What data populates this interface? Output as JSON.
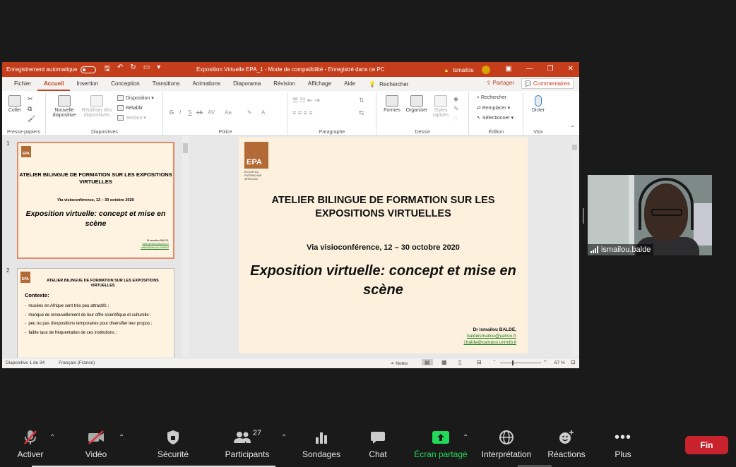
{
  "powerpoint": {
    "titlebar": {
      "autosave_label": "Enregistrement automatique",
      "doc_title": "Exposition Virtuelle EPA_1  -  Mode de compatibilité  -  Enregistré dans ce PC",
      "user": "Ismailou",
      "user_initial": "I"
    },
    "tabs": [
      "Fichier",
      "Accueil",
      "Insertion",
      "Conception",
      "Transitions",
      "Animations",
      "Diaporama",
      "Révision",
      "Affichage",
      "Aide"
    ],
    "search_label": "Rechercher",
    "share_label": "Partager",
    "comments_label": "Commentaires",
    "ribbon": {
      "clipboard": {
        "paste": "Coller",
        "group": "Presse-papiers"
      },
      "slides": {
        "new_slide": "Nouvelle diapositive",
        "reuse": "Réutiliser des diapositives",
        "layout": "Disposition",
        "reset": "Rétablir",
        "section": "Section",
        "group": "Diapositives"
      },
      "font": {
        "group": "Police",
        "bold": "G",
        "italic": "I",
        "underline": "S",
        "strike": "ab",
        "spacing": "AV",
        "case": "Aa"
      },
      "paragraph": {
        "group": "Paragraphe"
      },
      "drawing": {
        "shapes": "Formes",
        "arrange": "Organiser",
        "quick_styles": "Styles rapides",
        "group": "Dessin"
      },
      "editing": {
        "find": "Rechercher",
        "replace": "Remplacer",
        "select": "Sélectionner",
        "group": "Édition"
      },
      "voice": {
        "dictate": "Dicter",
        "group": "Voix"
      }
    },
    "thumbnails": [
      {
        "number": "1",
        "title": "ATELIER BILINGUE DE FORMATION SUR LES EXPOSITIONS VIRTUELLES",
        "via": "Via visioconférence, 12 – 30 octobre 2020",
        "expo": "Exposition virtuelle: concept et mise en scène",
        "author": "Dr Ismailou BALDE,",
        "email1": "baldeismailou@yahoo.fr",
        "email2": "i.balde@campus.unimib.it"
      },
      {
        "number": "2",
        "title": "ATELIER BILINGUE DE FORMATION SUR LES EXPOSITIONS VIRTUELLES",
        "context_heading": "Contexte:",
        "bullets": [
          "musées en Afrique sont très peu attractifs ;",
          "manque de renouvellement de leur offre scientifique et culturelle ;",
          "peu ou pas d'expositions temporaires pour diversifier leur propos ;",
          "faible taux de fréquentation de ces institutions ;"
        ]
      }
    ],
    "slide": {
      "logo_text": "EPA",
      "logo_sub": "ÉCOLE DU PATRIMOINE AFRICAIN",
      "title": "ATELIER BILINGUE DE FORMATION SUR LES EXPOSITIONS VIRTUELLES",
      "via": "Via visioconférence, 12 – 30 octobre 2020",
      "expo": "Exposition virtuelle: concept et mise en scène",
      "author": "Dr Ismailou BALDE,",
      "email1": "baldeismailou@yahoo.fr",
      "email2": "i.balde@campus.unimib.it"
    },
    "statusbar": {
      "slide_count": "Diapositive 1 de 34",
      "language": "Français (France)",
      "notes": "Notes",
      "zoom": "67 %"
    }
  },
  "video": {
    "participant_name": "ismailou.balde"
  },
  "zoom_toolbar": {
    "mute": "Activer",
    "video": "Vidéo",
    "security": "Sécurité",
    "participants": "Participants",
    "participants_count": "27",
    "polls": "Sondages",
    "chat": "Chat",
    "share": "Écran partagé",
    "interpretation": "Interprétation",
    "reactions": "Réactions",
    "more": "Plus",
    "end": "Fin",
    "share_color": "#23d959",
    "end_color": "#c8232c"
  }
}
